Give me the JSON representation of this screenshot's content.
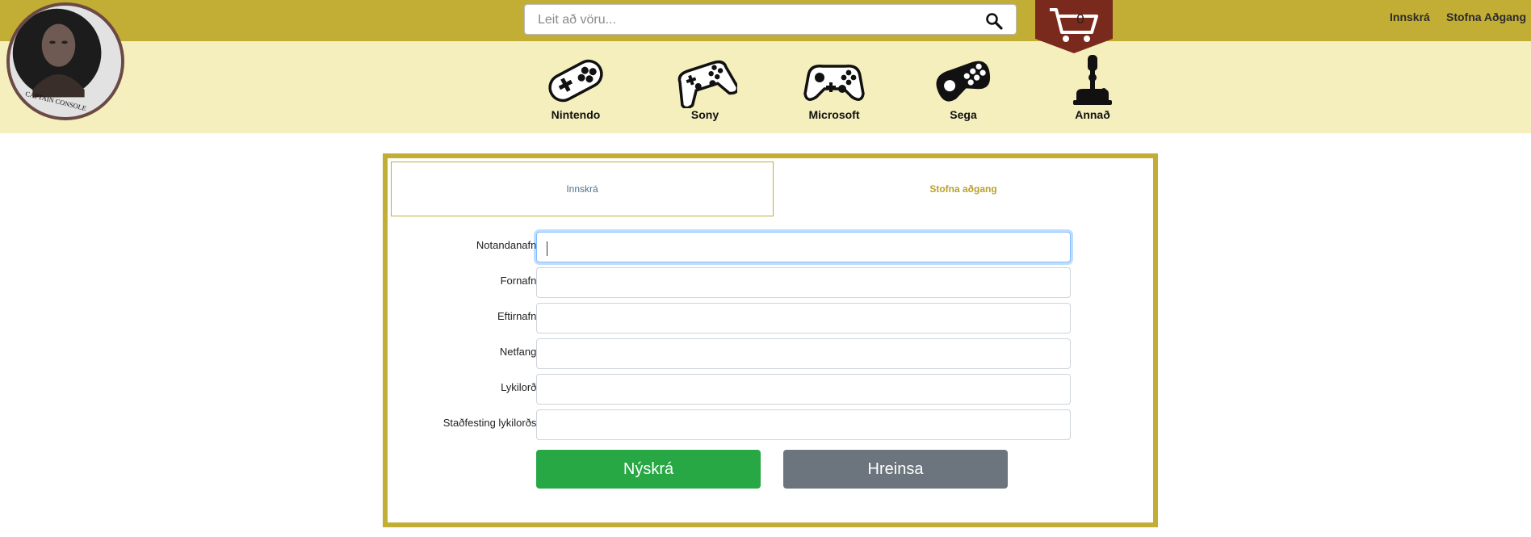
{
  "header": {
    "logo_text": "CAPTAIN CONSOLE",
    "search": {
      "placeholder": "Leit að vöru...",
      "value": ""
    },
    "cart": {
      "count": "0"
    },
    "links": {
      "login": "Innskrá",
      "signup": "Stofna Aðgang"
    }
  },
  "nav": [
    {
      "label": "Nintendo",
      "icon": "snes-controller-icon"
    },
    {
      "label": "Sony",
      "icon": "playstation-controller-icon"
    },
    {
      "label": "Microsoft",
      "icon": "xbox-controller-icon"
    },
    {
      "label": "Sega",
      "icon": "sega-controller-icon"
    },
    {
      "label": "Annað",
      "icon": "joystick-icon"
    }
  ],
  "form": {
    "tabs": {
      "login": "Innskrá",
      "signup": "Stofna aðgang"
    },
    "fields": [
      {
        "label": "Notandanafn:",
        "value": ""
      },
      {
        "label": "Fornafn:",
        "value": ""
      },
      {
        "label": "Eftirnafn:",
        "value": ""
      },
      {
        "label": "Netfang:",
        "value": ""
      },
      {
        "label": "Lykilorð:",
        "value": ""
      },
      {
        "label": "Staðfesting lykilorðs:",
        "value": ""
      }
    ],
    "submit_label": "Nýskrá",
    "clear_label": "Hreinsa"
  },
  "colors": {
    "brand_gold": "#c2ae35",
    "cream": "#f5efbd",
    "cart_maroon": "#7a2a1c",
    "submit_green": "#28a745",
    "clear_grey": "#6c757d"
  }
}
